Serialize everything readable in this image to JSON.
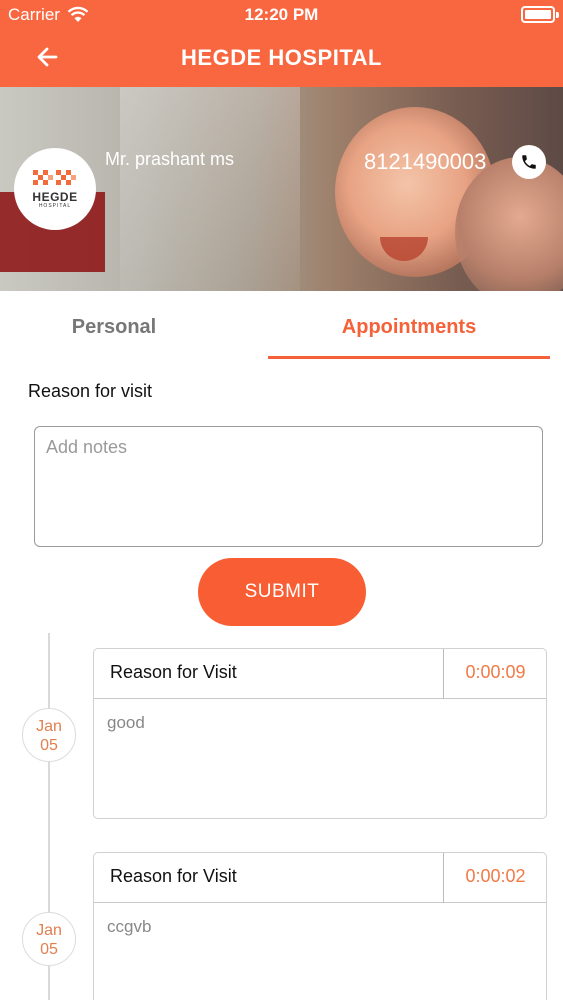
{
  "status_bar": {
    "carrier": "Carrier",
    "time": "12:20 PM"
  },
  "header": {
    "title": "HEGDE HOSPITAL"
  },
  "hero": {
    "logo_text": "HEGDE",
    "logo_subtext": "HOSPITAL",
    "patient_name": "Mr. prashant ms",
    "phone": "8121490003"
  },
  "tabs": [
    {
      "label": "Personal",
      "active": false
    },
    {
      "label": "Appointments",
      "active": true
    }
  ],
  "form": {
    "reason_label": "Reason for visit",
    "notes_placeholder": "Add notes",
    "notes_value": "",
    "submit_label": "SUBMIT"
  },
  "appointments": [
    {
      "month": "Jan",
      "day": "05",
      "title": "Reason for Visit",
      "timer": "0:00:09",
      "note": "good"
    },
    {
      "month": "Jan",
      "day": "05",
      "title": "Reason for Visit",
      "timer": "0:00:02",
      "note": "ccgvb"
    }
  ],
  "colors": {
    "accent": "#f96740",
    "tab_active": "#f5623a",
    "timer": "#f07a45"
  }
}
